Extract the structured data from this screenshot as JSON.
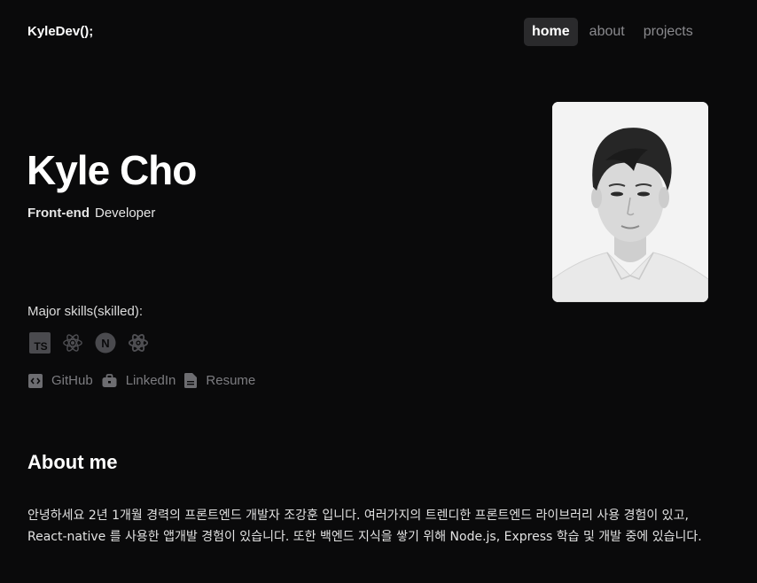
{
  "header": {
    "brand": "KyleDev();",
    "nav": {
      "home": "home",
      "about": "about",
      "projects": "projects"
    }
  },
  "hero": {
    "name": "Kyle Cho",
    "role_strong": "Front-end",
    "role_rest": "Developer"
  },
  "skills": {
    "title": "Major skills(skilled):",
    "icons": [
      "typescript-icon",
      "react-icon",
      "nextjs-icon",
      "redux-icon"
    ]
  },
  "links": {
    "github": "GitHub",
    "linkedin": "LinkedIn",
    "resume": "Resume"
  },
  "about": {
    "title": "About me",
    "body": "안녕하세요 2년 1개월 경력의 프론트엔드 개발자 조강훈 입니다. 여러가지의 트렌디한 프론트엔드 라이브러리 사용 경험이 있고, React-native 를 사용한 앱개발 경험이 있습니다. 또한 백엔드 지식을 쌓기 위해 Node.js, Express 학습 및 개발 중에 있습니다."
  },
  "colors": {
    "background": "#0a0a0b",
    "nav_active_bg": "#2a2a2c",
    "muted": "#7c7c80"
  }
}
